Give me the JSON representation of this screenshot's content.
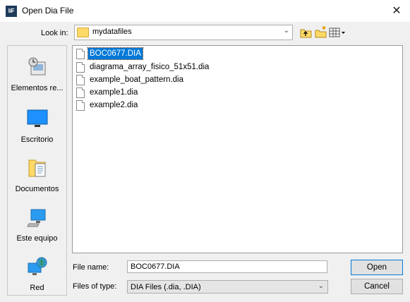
{
  "window": {
    "title": "Open Dia File",
    "app_icon_text": "liF",
    "close_glyph": "✕"
  },
  "lookin": {
    "label": "Look in:",
    "value": "mydatafiles"
  },
  "places": [
    {
      "label": "Elementos re...",
      "icon": "recent-items-icon"
    },
    {
      "label": "Escritorio",
      "icon": "desktop-icon"
    },
    {
      "label": "Documentos",
      "icon": "documents-icon"
    },
    {
      "label": "Este equipo",
      "icon": "computer-icon"
    },
    {
      "label": "Red",
      "icon": "network-icon"
    }
  ],
  "files": [
    {
      "name": "BOC0677.DIA",
      "selected": true
    },
    {
      "name": "diagrama_array_fisico_51x51.dia",
      "selected": false
    },
    {
      "name": "example_boat_pattern.dia",
      "selected": false
    },
    {
      "name": "example1.dia",
      "selected": false
    },
    {
      "name": "example2.dia",
      "selected": false
    }
  ],
  "filename": {
    "label": "File name:",
    "value": "BOC0677.DIA"
  },
  "filetype": {
    "label": "Files of type:",
    "value": "DIA Files (.dia, .DIA)"
  },
  "buttons": {
    "open": "Open",
    "cancel": "Cancel"
  },
  "colors": {
    "selection": "#0078d7",
    "folder": "#ffd966"
  }
}
